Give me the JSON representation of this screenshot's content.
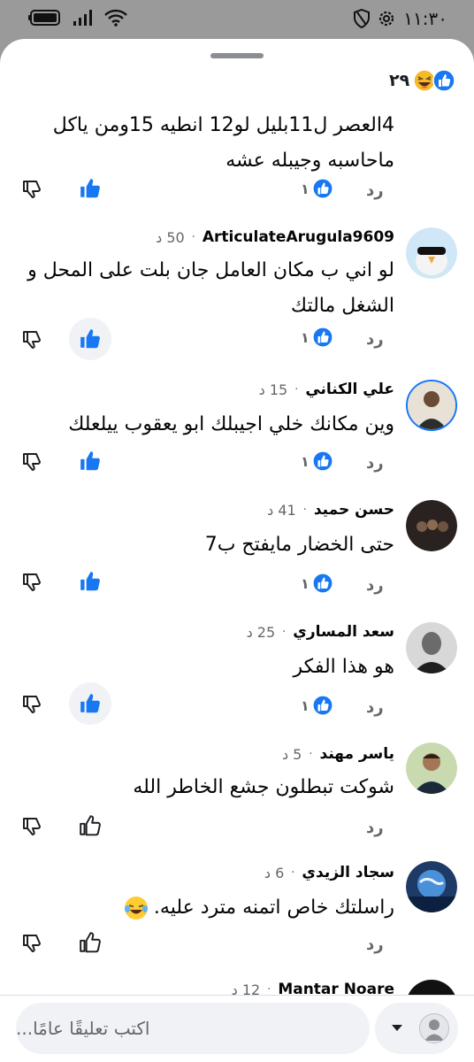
{
  "status_bar": {
    "time": "١١:٣٠"
  },
  "reactions_summary": {
    "count": "٢٩"
  },
  "labels": {
    "reply": "رد",
    "dot": "·"
  },
  "comments": [
    {
      "text": "4العصر ل11بليل لو12 انطيه 15ومن ياكل ماحاسبه وجيبله عشه",
      "likes": "١"
    },
    {
      "name": "ArticulateArugula9609",
      "time": "50 د",
      "text": "لو اني ب مكان العامل جان بلت على المحل و الشغل مالتك",
      "likes": "١"
    },
    {
      "name": "علي الكناني",
      "time": "15 د",
      "text": "وين مكانك خلي اجيبلك ابو يعقوب ييلعلك",
      "likes": "١"
    },
    {
      "name": "حسن حميد",
      "time": "41 د",
      "text": "حتى الخضار مايفتح ب7",
      "likes": "١"
    },
    {
      "name": "سعد المساري",
      "time": "25 د",
      "text": "هو هذا الفكر",
      "likes": "١"
    },
    {
      "name": "ياسر مهند",
      "time": "5 د",
      "text": "شوكت تبطلون جشع الخاطر الله"
    },
    {
      "name": "سجاد الزيدي",
      "time": "6 د",
      "text": "راسلتك خاص  اتمنه مترد عليه."
    },
    {
      "name": "Mantar Noare",
      "time": "12 د"
    }
  ],
  "composer": {
    "placeholder": "اكتب تعليقًا عامًا..."
  },
  "colors": {
    "accent": "#1877f2",
    "sheet_bg": "#ffffff",
    "backdrop": "#9a9a9a"
  }
}
